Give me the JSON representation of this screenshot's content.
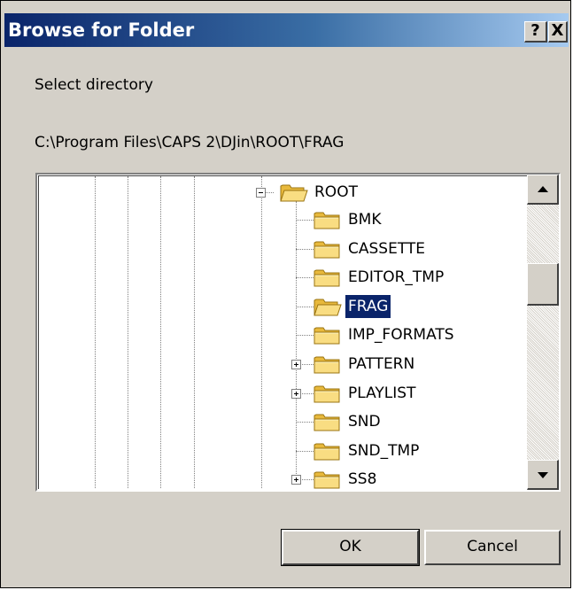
{
  "dialog": {
    "title": "Browse for Folder",
    "help_glyph": "?",
    "close_glyph": "X",
    "prompt": "Select directory",
    "current_path": "C:\\Program Files\\CAPS 2\\DJin\\ROOT\\FRAG"
  },
  "tree": {
    "root": {
      "label": "ROOT",
      "expanded": true
    },
    "items": [
      {
        "label": "BMK",
        "has_children": false,
        "selected": false
      },
      {
        "label": "CASSETTE",
        "has_children": false,
        "selected": false
      },
      {
        "label": "EDITOR_TMP",
        "has_children": false,
        "selected": false
      },
      {
        "label": "FRAG",
        "has_children": false,
        "selected": true
      },
      {
        "label": "IMP_FORMATS",
        "has_children": false,
        "selected": false
      },
      {
        "label": "PATTERN",
        "has_children": true,
        "selected": false
      },
      {
        "label": "PLAYLIST",
        "has_children": true,
        "selected": false
      },
      {
        "label": "SND",
        "has_children": false,
        "selected": false
      },
      {
        "label": "SND_TMP",
        "has_children": false,
        "selected": false
      },
      {
        "label": "SS8",
        "has_children": true,
        "selected": false
      }
    ]
  },
  "buttons": {
    "ok": "OK",
    "cancel": "Cancel"
  },
  "colors": {
    "titlebar_start": "#0a246a",
    "titlebar_end": "#a6caf0",
    "selection": "#0a246a",
    "face": "#d4d0c8",
    "folder": "#f5d36a"
  }
}
